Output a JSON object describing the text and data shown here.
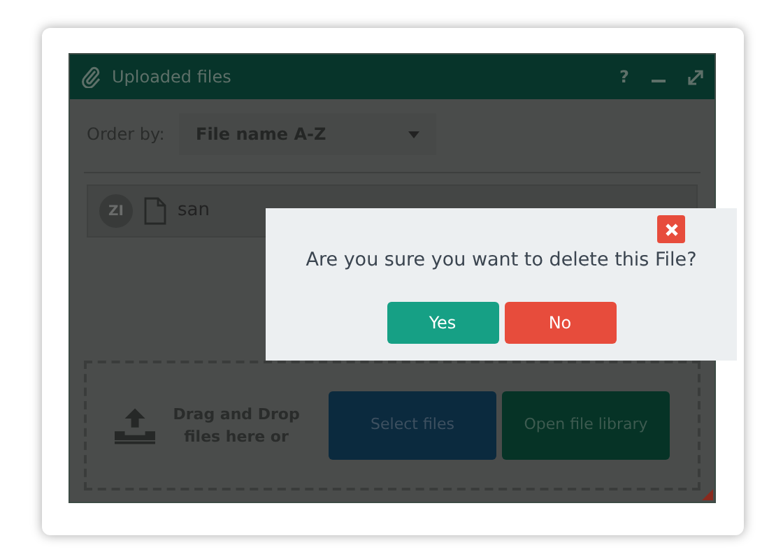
{
  "window": {
    "title": "Uploaded files",
    "controls": [
      "?"
    ]
  },
  "order_by": {
    "label": "Order by:",
    "value": "File name A-Z"
  },
  "files": [
    {
      "avatar": "ZI",
      "name": "san"
    }
  ],
  "drop_zone": {
    "text": "Drag and Drop files here or",
    "buttons": [
      {
        "label": "Select files",
        "kind": "primary"
      },
      {
        "label": "Open file library",
        "kind": "secondary"
      }
    ]
  },
  "dialog": {
    "question": "Are you sure you want to delete this File?",
    "buttons": [
      {
        "label": "Yes",
        "kind": "confirm"
      },
      {
        "label": "No",
        "kind": "cancel"
      }
    ]
  }
}
